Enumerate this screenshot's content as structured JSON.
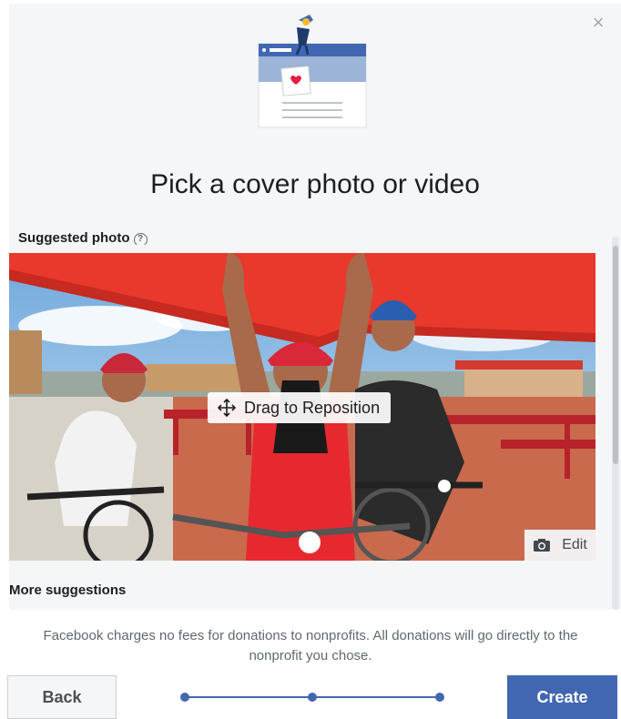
{
  "dialog": {
    "title": "Pick a cover photo or video",
    "close_icon": "×",
    "suggested_label": "Suggested photo",
    "help_glyph": "?",
    "drag_label": "Drag to Reposition",
    "edit_label": "Edit",
    "more_suggestions_label": "More suggestions"
  },
  "footer": {
    "note": "Facebook charges no fees for donations to nonprofits. All donations will go directly to the nonprofit you chose.",
    "back_label": "Back",
    "create_label": "Create"
  },
  "stepper": {
    "total_steps": 3,
    "current_step": 3
  },
  "colors": {
    "brand_blue": "#4267b2",
    "dialog_bg": "#f5f6f7",
    "muted_text": "#606770"
  },
  "icons": {
    "close": "close-icon",
    "help": "help-circle-icon",
    "move": "move-arrows-icon",
    "camera": "camera-icon"
  }
}
